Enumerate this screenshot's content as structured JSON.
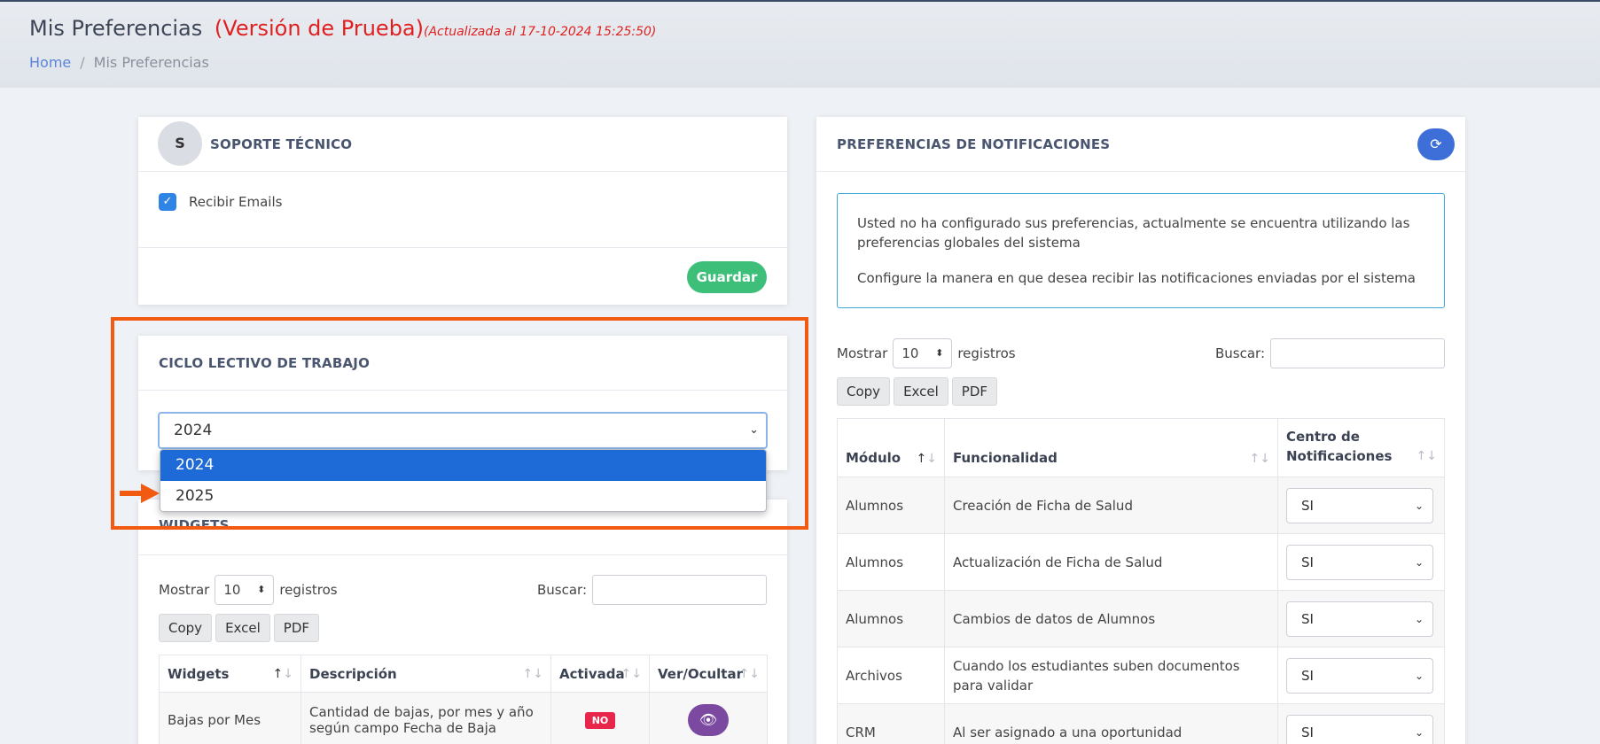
{
  "header": {
    "title": "Mis Preferencias",
    "version_tag": "(Versión de Prueba)",
    "updated": "(Actualizada al 17-10-2024 15:25:50)",
    "breadcrumb_home": "Home",
    "breadcrumb_sep": "/",
    "breadcrumb_current": "Mis Preferencias"
  },
  "soporte": {
    "avatar_letter": "S",
    "title": "SOPORTE TÉCNICO",
    "checkbox_label": "Recibir Emails",
    "checkbox_checked": true,
    "save_label": "Guardar"
  },
  "ciclo": {
    "title": "CICLO LECTIVO DE TRABAJO",
    "selected": "2024",
    "options": [
      "2024",
      "2025"
    ]
  },
  "widgets": {
    "title": "WIDGETS",
    "show_label": "Mostrar",
    "page_size": "10",
    "records_label": "registros",
    "search_label": "Buscar:",
    "buttons": [
      "Copy",
      "Excel",
      "PDF"
    ],
    "columns": [
      "Widgets",
      "Descripción",
      "Activada",
      "Ver/Ocultar"
    ],
    "rows": [
      {
        "widget": "Bajas por Mes",
        "descripcion": "Cantidad de bajas, por mes y año según campo Fecha de Baja",
        "activada": "NO"
      }
    ]
  },
  "notificaciones": {
    "title": "PREFERENCIAS DE NOTIFICACIONES",
    "info_line1": "Usted no ha configurado sus preferencias, actualmente se encuentra utilizando las preferencias globales del sistema",
    "info_line2": "Configure la manera en que desea recibir las notificaciones enviadas por el sistema",
    "show_label": "Mostrar",
    "page_size": "10",
    "records_label": "registros",
    "search_label": "Buscar:",
    "buttons": [
      "Copy",
      "Excel",
      "PDF"
    ],
    "columns": [
      "Módulo",
      "Funcionalidad",
      "Centro de Notificaciones"
    ],
    "rows": [
      {
        "modulo": "Alumnos",
        "funcionalidad": "Creación de Ficha de Salud",
        "centro": "SI"
      },
      {
        "modulo": "Alumnos",
        "funcionalidad": "Actualización de Ficha de Salud",
        "centro": "SI"
      },
      {
        "modulo": "Alumnos",
        "funcionalidad": "Cambios de datos de Alumnos",
        "centro": "SI"
      },
      {
        "modulo": "Archivos",
        "funcionalidad": "Cuando los estudiantes suben documentos para validar",
        "centro": "SI"
      },
      {
        "modulo": "CRM",
        "funcionalidad": "Al ser asignado a una oportunidad",
        "centro": "SI"
      }
    ]
  },
  "colors": {
    "accent_blue": "#1e6ad6",
    "success_green": "#3dbf7a",
    "danger_red": "#e8254a",
    "highlight_orange": "#f25a12",
    "purple": "#7b4aa0"
  }
}
